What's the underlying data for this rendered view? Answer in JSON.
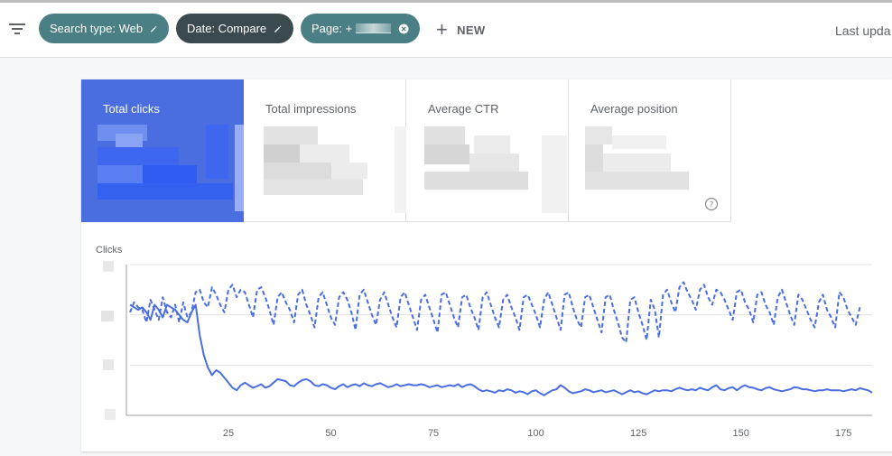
{
  "filters": {
    "chips": [
      {
        "label": "Search type: Web",
        "icon": "edit-icon"
      },
      {
        "label": "Date: Compare",
        "icon": "edit-icon"
      },
      {
        "label": "Page: +",
        "icon": "close-circle-icon"
      }
    ],
    "new_label": "NEW",
    "last_updated_label": "Last upda"
  },
  "metrics": [
    {
      "label": "Total clicks",
      "active": true
    },
    {
      "label": "Total impressions",
      "active": false
    },
    {
      "label": "Average CTR",
      "active": false
    },
    {
      "label": "Average position",
      "active": false
    }
  ],
  "colors": {
    "accent": "#4a6ee0",
    "chip_teal": "#4a7f86",
    "chip_dark": "#3b4a4f",
    "line": "#4a6ee0"
  },
  "chart_data": {
    "type": "line",
    "ylabel": "Clicks",
    "x_ticks": [
      25,
      50,
      75,
      100,
      125,
      150,
      175
    ],
    "xlim": [
      1,
      182
    ],
    "ylim": [
      0,
      3
    ],
    "grid": true,
    "series": [
      {
        "style": "dashed",
        "values": [
          2.05,
          2.25,
          2.15,
          2.1,
          1.85,
          2.3,
          2.1,
          1.9,
          2.35,
          2.05,
          1.95,
          2.2,
          1.85,
          2.25,
          1.95,
          2.05,
          2.45,
          2.5,
          2.25,
          2.15,
          2.55,
          2.4,
          2.2,
          2.05,
          2.5,
          2.6,
          2.35,
          2.5,
          2.45,
          2.2,
          1.95,
          2.5,
          2.55,
          2.35,
          2.1,
          1.8,
          2.35,
          2.45,
          2.25,
          2.1,
          1.85,
          2.4,
          2.5,
          2.2,
          2.0,
          1.75,
          2.35,
          2.45,
          2.2,
          1.95,
          1.8,
          2.35,
          2.45,
          2.3,
          2.05,
          1.7,
          2.4,
          2.5,
          2.25,
          2.0,
          1.8,
          2.3,
          2.45,
          2.2,
          1.95,
          1.75,
          2.35,
          2.45,
          2.2,
          1.95,
          1.7,
          2.3,
          2.4,
          2.15,
          1.9,
          1.65,
          2.4,
          2.45,
          2.2,
          1.95,
          1.75,
          2.35,
          2.4,
          2.15,
          1.95,
          1.7,
          2.35,
          2.45,
          2.2,
          1.95,
          1.75,
          2.3,
          2.4,
          2.15,
          1.95,
          1.7,
          2.35,
          2.4,
          2.2,
          2.0,
          1.75,
          2.3,
          2.45,
          2.2,
          1.95,
          1.7,
          2.4,
          2.45,
          2.15,
          1.9,
          1.75,
          2.35,
          2.4,
          2.15,
          1.9,
          1.65,
          2.35,
          2.4,
          2.1,
          1.85,
          1.55,
          1.45,
          2.3,
          2.35,
          2.05,
          1.8,
          1.5,
          2.3,
          2.1,
          1.55,
          2.4,
          2.5,
          2.25,
          2.05,
          2.55,
          2.65,
          2.45,
          2.3,
          2.1,
          2.5,
          2.6,
          2.35,
          2.2,
          2.5,
          2.45,
          2.3,
          2.1,
          1.9,
          2.45,
          2.5,
          2.25,
          2.1,
          1.85,
          2.4,
          2.45,
          2.2,
          2.05,
          1.8,
          2.35,
          2.5,
          2.25,
          2.0,
          1.8,
          2.4,
          2.3,
          2.1,
          1.9,
          1.75,
          2.25,
          2.4,
          2.1,
          1.95,
          1.75,
          2.45,
          2.35,
          2.1,
          1.95,
          1.8,
          2.15
        ]
      },
      {
        "style": "solid",
        "values": [
          2.2,
          2.15,
          2.1,
          2.15,
          2.05,
          1.9,
          2.2,
          2.1,
          1.95,
          2.2,
          2.15,
          2.1,
          2.0,
          1.9,
          1.85,
          2.05,
          2.2,
          1.6,
          1.2,
          0.95,
          0.8,
          0.9,
          0.85,
          0.75,
          0.65,
          0.55,
          0.5,
          0.6,
          0.65,
          0.6,
          0.55,
          0.58,
          0.62,
          0.55,
          0.58,
          0.65,
          0.72,
          0.7,
          0.68,
          0.6,
          0.58,
          0.65,
          0.7,
          0.72,
          0.68,
          0.6,
          0.58,
          0.62,
          0.6,
          0.55,
          0.52,
          0.58,
          0.62,
          0.56,
          0.6,
          0.62,
          0.58,
          0.64,
          0.6,
          0.58,
          0.62,
          0.64,
          0.6,
          0.56,
          0.58,
          0.62,
          0.58,
          0.6,
          0.62,
          0.6,
          0.6,
          0.62,
          0.6,
          0.56,
          0.58,
          0.6,
          0.56,
          0.58,
          0.6,
          0.58,
          0.62,
          0.56,
          0.6,
          0.62,
          0.58,
          0.52,
          0.48,
          0.5,
          0.48,
          0.45,
          0.5,
          0.48,
          0.52,
          0.5,
          0.45,
          0.48,
          0.46,
          0.42,
          0.48,
          0.5,
          0.44,
          0.4,
          0.45,
          0.5,
          0.52,
          0.6,
          0.55,
          0.48,
          0.44,
          0.46,
          0.48,
          0.52,
          0.5,
          0.46,
          0.48,
          0.5,
          0.46,
          0.48,
          0.5,
          0.46,
          0.42,
          0.46,
          0.5,
          0.46,
          0.48,
          0.44,
          0.42,
          0.46,
          0.5,
          0.48,
          0.5,
          0.5,
          0.48,
          0.52,
          0.55,
          0.52,
          0.5,
          0.52,
          0.5,
          0.55,
          0.52,
          0.5,
          0.56,
          0.6,
          0.52,
          0.5,
          0.54,
          0.56,
          0.5,
          0.56,
          0.6,
          0.56,
          0.55,
          0.52,
          0.5,
          0.54,
          0.56,
          0.52,
          0.5,
          0.48,
          0.5,
          0.52,
          0.56,
          0.55,
          0.52,
          0.52,
          0.5,
          0.48,
          0.5,
          0.5,
          0.52,
          0.5,
          0.5,
          0.5,
          0.48,
          0.5,
          0.52,
          0.5,
          0.54,
          0.52,
          0.5,
          0.45
        ]
      }
    ]
  }
}
